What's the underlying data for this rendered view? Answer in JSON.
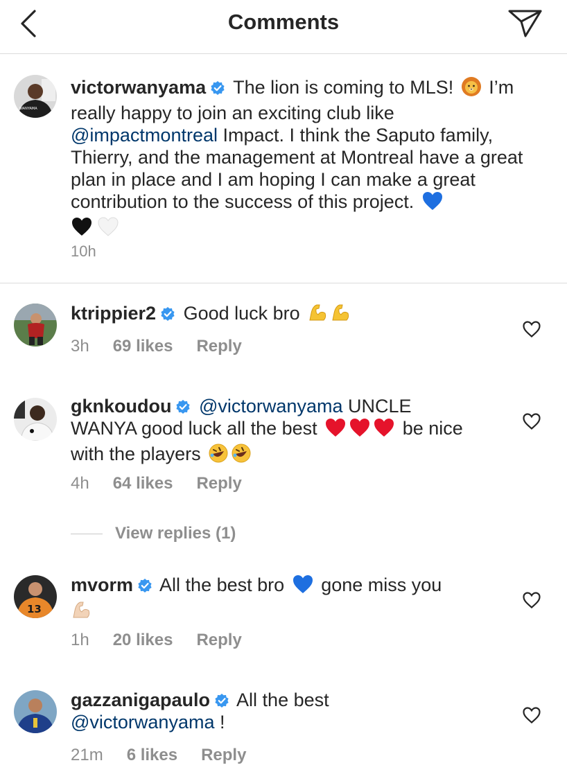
{
  "header": {
    "title": "Comments",
    "back_icon": "chevron-left-icon",
    "share_icon": "paper-plane-icon"
  },
  "caption": {
    "username": "victorwanyama",
    "text_1": "The lion is coming to MLS!",
    "text_2": "I’m really happy to join an exciting club like",
    "mention": "@impactmontreal",
    "text_3": "Impact. I think the Saputo family, Thierry, and the management at Montreal have a great plan in place and I am hoping I can make a great contribution to the success of this project.",
    "time": "10h",
    "avatar_badge": "WANYAMA"
  },
  "comments": [
    {
      "username": "ktrippier2",
      "text": "Good luck bro",
      "time": "3h",
      "likes": "69 likes",
      "reply": "Reply"
    },
    {
      "username": "gknkoudou",
      "mention": "@victorwanyama",
      "text_1": "UNCLE WANYA good luck all the best",
      "text_2": "be nice with the players",
      "time": "4h",
      "likes": "64 likes",
      "reply": "Reply",
      "view_replies": "View replies (1)"
    },
    {
      "username": "mvorm",
      "text_1": "All the best bro",
      "text_2": "gone miss you",
      "time": "1h",
      "likes": "20 likes",
      "reply": "Reply",
      "avatar_number": "13"
    },
    {
      "username": "gazzanigapaulo",
      "text": "All the best",
      "mention": "@victorwanyama",
      "text_after": "!",
      "time": "21m",
      "likes": "6 likes",
      "reply": "Reply"
    }
  ],
  "colors": {
    "text": "#262626",
    "secondary": "#8e8e8e",
    "mention": "#00376b",
    "verified": "#3897f0",
    "divider": "#dbdbdb"
  }
}
